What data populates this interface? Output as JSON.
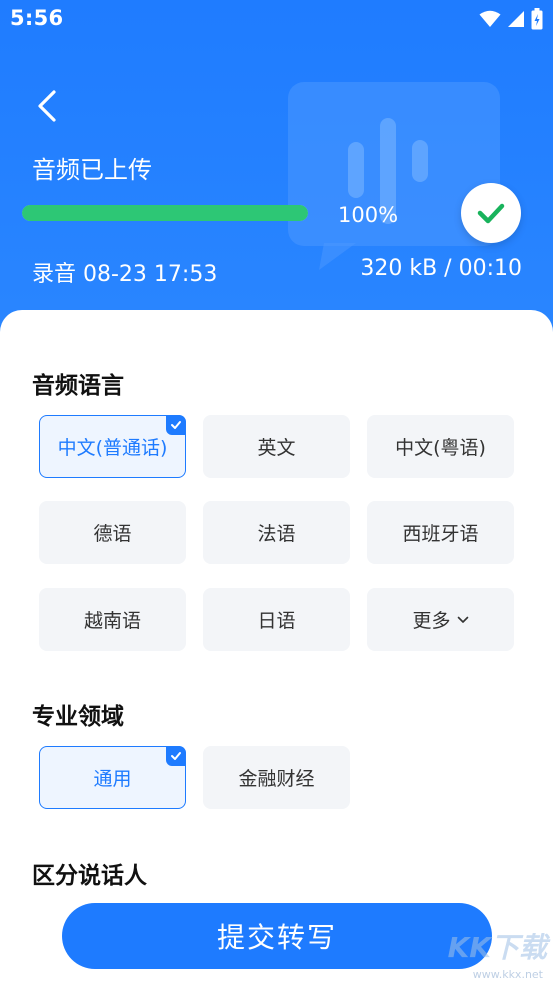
{
  "status_bar": {
    "time": "5:56"
  },
  "header": {
    "title": "音频已上传",
    "progress_percent": 100,
    "progress_text": "100%",
    "recording_name": "录音 08-23 17:53",
    "recording_meta": "320 kB /  00:10"
  },
  "language_section": {
    "title": "音频语言",
    "options": [
      "中文(普通话)",
      "英文",
      "中文(粤语)",
      "德语",
      "法语",
      "西班牙语",
      "越南语",
      "日语",
      "更多"
    ],
    "selected": "中文(普通话)"
  },
  "domain_section": {
    "title": "专业领域",
    "options": [
      "通用",
      "金融财经"
    ],
    "selected": "通用"
  },
  "speaker_section": {
    "title": "区分说话人"
  },
  "submit_label": "提交转写",
  "watermark": {
    "logo": "KK下载",
    "url": "www.kkx.net"
  },
  "colors": {
    "primary": "#1E7BFF",
    "progress": "#2DC775",
    "chip_bg": "#F3F5F8"
  }
}
